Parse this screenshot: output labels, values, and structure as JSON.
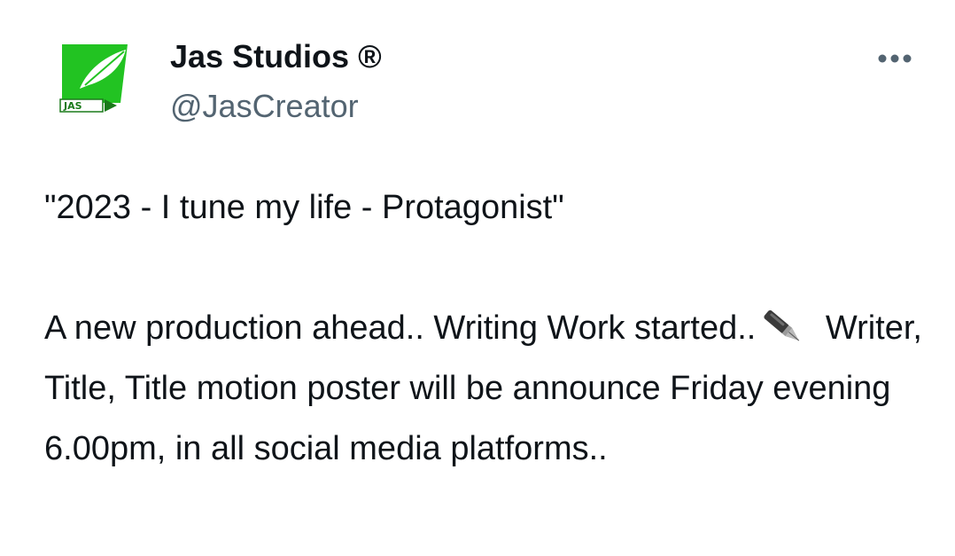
{
  "account": {
    "display_name": "Jas Studios ®",
    "handle": "@JasCreator",
    "avatar_logo_text": "JAS"
  },
  "actions": {
    "more_icon": "more-horizontal-icon"
  },
  "tweet": {
    "quote": "\"2023 - I tune my life -  Protagonist\"",
    "para_part1": "A new production ahead.. Writing Work started..",
    "emoji": "fountain-pen-icon",
    "para_part2": " Writer, Title, Title motion poster will be announce Friday evening 6.00pm, in all social media platforms.."
  },
  "colors": {
    "text": "#0f1419",
    "secondary_text": "#536471",
    "avatar_green": "#22c322",
    "avatar_dark": "#1a7a1a"
  }
}
